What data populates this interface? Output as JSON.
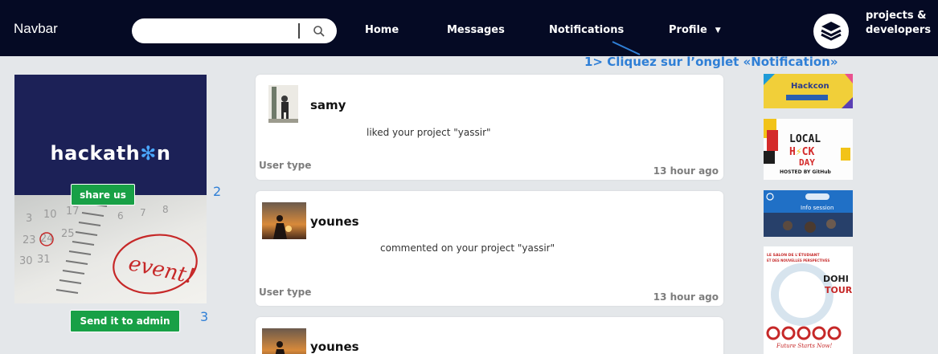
{
  "navbar": {
    "brand": "Navbar",
    "search": {
      "value": "",
      "placeholder": ""
    },
    "links": [
      "Home",
      "Messages",
      "Notifications",
      "Profile"
    ],
    "logo_text_line1": "projects &",
    "logo_text_line2": "developers"
  },
  "annotations": {
    "step1": "1> Cliquez sur l’onglet «Notification»",
    "step2": "2",
    "step3": "3"
  },
  "ad": {
    "title_part1": "hackath",
    "title_part2": "n",
    "share_button": "share us",
    "admin_button": "Send it to admin",
    "image_text": "event!"
  },
  "notifications": [
    {
      "username": "samy",
      "message": "liked your project \"yassir\"",
      "user_type": "User type",
      "time": "13 hour ago"
    },
    {
      "username": "younes",
      "message": "commented on your project \"yassir\"",
      "user_type": "User type",
      "time": "13 hour ago"
    },
    {
      "username": "younes"
    }
  ],
  "side_ads": {
    "ad1_title": "Hackcon",
    "ad2_line1": "LOCAL",
    "ad2_line2": "H",
    "ad2_line2b": "CK",
    "ad2_line3": "DAY",
    "ad2_footer": "HOSTED BY GitHub",
    "ad3_text": "Info session",
    "ad4_title1": "LE SALON DE L'ÉTUDIANT",
    "ad4_title2": "ET DES NOUVELLES PERSPECTIVES",
    "ad4_tour_top": "DOHI",
    "ad4_tour": "TOUR",
    "ad4_footer": "Future Starts Now!"
  },
  "colors": {
    "navbar_bg": "#050a24",
    "accent_blue": "#2f7fd6",
    "button_green": "#18a046",
    "page_bg": "#e4e7ea"
  }
}
